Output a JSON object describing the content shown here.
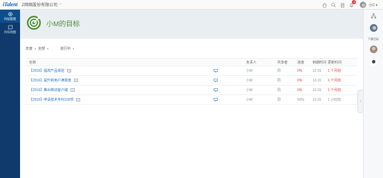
{
  "topbar": {
    "logo": "iTalent",
    "company": "Z网络股份有限公司",
    "notifications_count": "3",
    "user_name": "小C"
  },
  "sidebar": {
    "items": [
      {
        "label": "目标管理",
        "icon": "target-manage-icon",
        "active": true
      },
      {
        "label": "目标地图",
        "icon": "target-map-icon",
        "active": false
      }
    ]
  },
  "header": {
    "title": "小M的目标"
  },
  "filters": {
    "period_label": "年度",
    "scope": "全部",
    "status": "进行中"
  },
  "table": {
    "columns": {
      "name": "名称",
      "owner": "负责人",
      "share": "共享者",
      "progress": "进度",
      "due": "到期时间",
      "updated": "更新时间"
    },
    "rows": [
      {
        "name": "【2016】提高产品体验",
        "owner": "小M",
        "share": "周",
        "progress": "0%",
        "progress_color": "#e53935",
        "due": "12-31",
        "updated": "1 个月前",
        "updated_color": "#e53935"
      },
      {
        "name": "【2016】提升新用户满意度",
        "owner": "小M",
        "share": "周",
        "progress": "0%",
        "progress_color": "#e53935",
        "due": "12-31",
        "updated": "1 个月前",
        "updated_color": "#e53935"
      },
      {
        "name": "【2016】推出移动客户端",
        "owner": "小M",
        "share": "周",
        "progress": "0%",
        "progress_color": "#e53935",
        "due": "12-31",
        "updated": "1 个月前",
        "updated_color": "#e53935"
      },
      {
        "name": "【2016】申请技术专利100项",
        "owner": "小M",
        "share": "周",
        "progress": "60%",
        "progress_color": "#8a8f94",
        "due": "12-31",
        "updated": "1 小时前",
        "updated_color": "#8a8f94"
      }
    ]
  },
  "right_panel": {
    "label": "下属目标"
  },
  "colors": {
    "sidebar_bg": "#0f3a6b",
    "accent_blue": "#1f74c6",
    "title_green": "#4d8f35",
    "alert_red": "#e53935"
  }
}
